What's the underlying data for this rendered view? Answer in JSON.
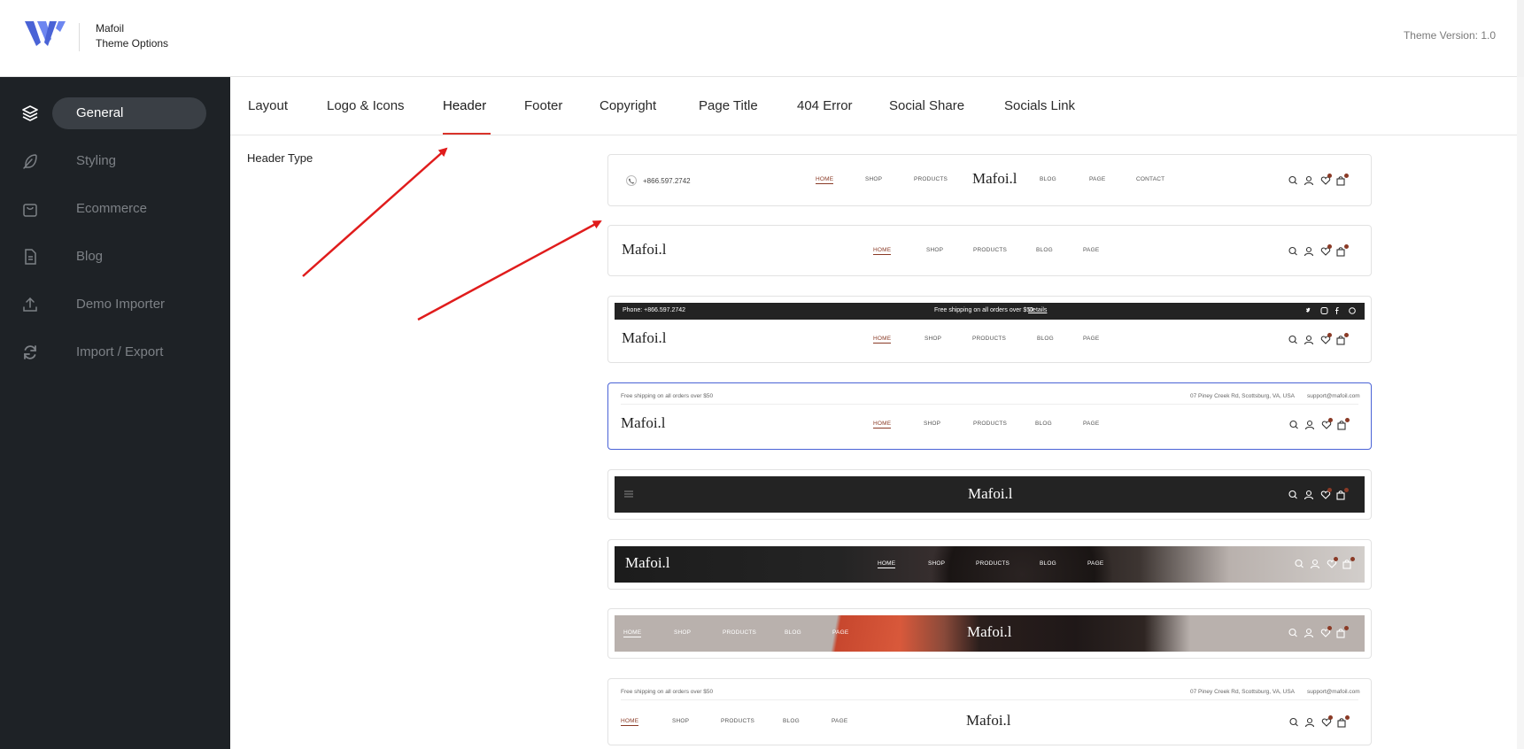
{
  "app": {
    "brand_name": "Mafoil",
    "brand_subtitle": "Theme Options",
    "version": "Theme Version: 1.0",
    "accent_color": "#d9342b",
    "sidebar_bg": "#1e2226",
    "logo_color": "#4a63d6"
  },
  "sidebar": {
    "items": [
      {
        "label": "General",
        "icon": "layers-icon",
        "active": true
      },
      {
        "label": "Styling",
        "icon": "feather-icon",
        "active": false
      },
      {
        "label": "Ecommerce",
        "icon": "shopping-bag-icon",
        "active": false
      },
      {
        "label": "Blog",
        "icon": "document-icon",
        "active": false
      },
      {
        "label": "Demo Importer",
        "icon": "upload-icon",
        "active": false
      },
      {
        "label": "Import / Export",
        "icon": "refresh-icon",
        "active": false
      }
    ]
  },
  "tabs": [
    {
      "label": "Layout"
    },
    {
      "label": "Logo & Icons"
    },
    {
      "label": "Header",
      "active": true
    },
    {
      "label": "Footer"
    },
    {
      "label": "Copyright"
    },
    {
      "label": "Page Title"
    },
    {
      "label": "404 Error"
    },
    {
      "label": "Social Share"
    },
    {
      "label": "Socials Link"
    }
  ],
  "content": {
    "field_label": "Header Type"
  },
  "previews": {
    "logo": "Mafoi.l",
    "phone": "+866.597.2742",
    "phone_label": "Phone: +866.597.2742",
    "shipping": "Free shipping on all orders over $50",
    "details": "Details",
    "address": "07 Piney Creek Rd, Scottsburg, VA, USA",
    "email": "support@mafoil.com",
    "nav": {
      "home": "HOME",
      "shop": "SHOP",
      "products": "PRODUCTS",
      "blog": "BLOG",
      "page": "PAGE",
      "contact": "CONTACT"
    },
    "selected_index": 3
  }
}
